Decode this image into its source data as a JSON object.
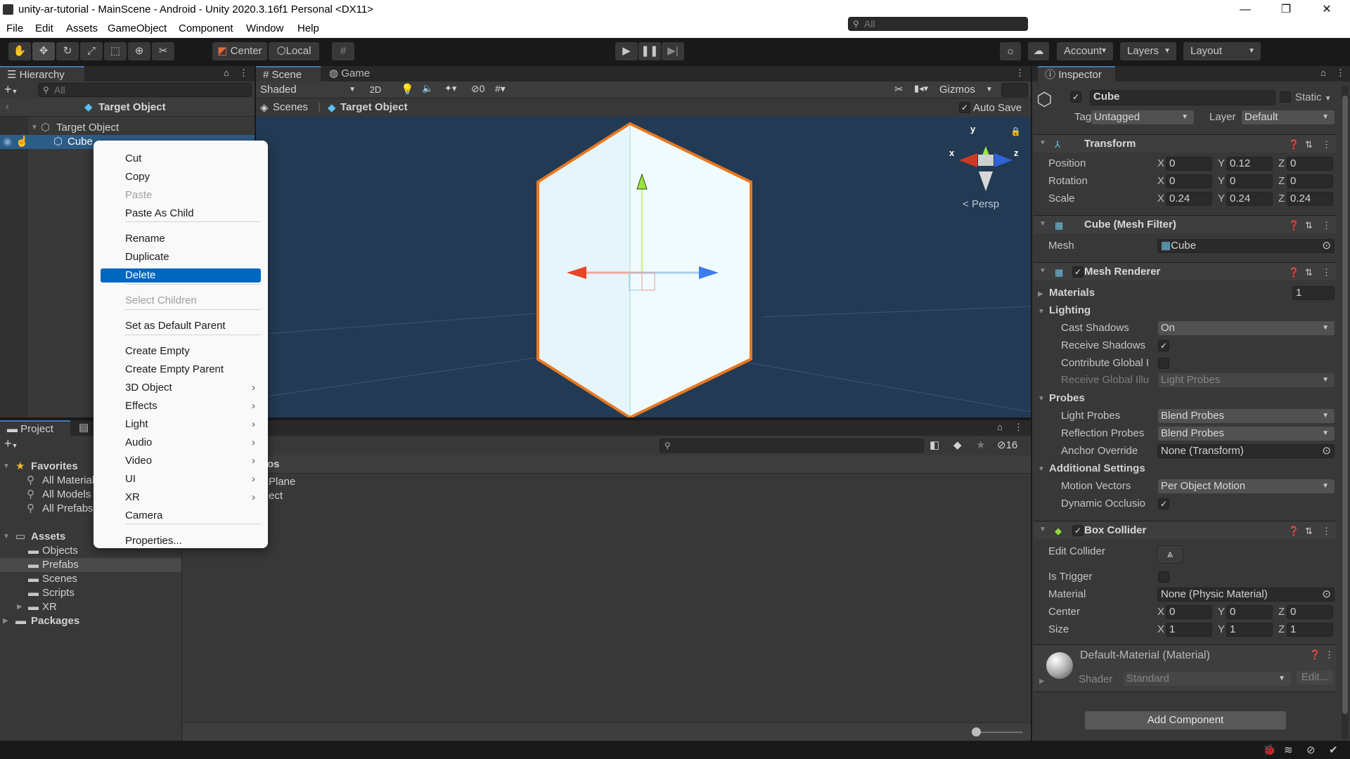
{
  "window": {
    "title": "unity-ar-tutorial - MainScene - Android - Unity 2020.3.16f1 Personal <DX11>",
    "minimize": "—",
    "maximize": "❐",
    "close": "✕"
  },
  "menubar": [
    "File",
    "Edit",
    "Assets",
    "GameObject",
    "Component",
    "Window",
    "Help"
  ],
  "toolbar": {
    "tools": [
      "hand-tool",
      "move-tool",
      "rotate-tool",
      "scale-tool",
      "rect-tool",
      "transform-tool",
      "custom-tool"
    ],
    "active_tool": "move-tool",
    "pivot_label": "Center",
    "space_label": "Local",
    "account_label": "Account",
    "layers_label": "Layers",
    "layout_label": "Layout"
  },
  "hierarchy": {
    "tab_label": "Hierarchy",
    "search_placeholder": "All",
    "breadcrumb": "Target Object",
    "items": [
      {
        "label": "Target Object",
        "expanded": true,
        "selected": false
      },
      {
        "label": "Cube",
        "selected": true
      }
    ]
  },
  "context_menu": {
    "items": [
      {
        "label": "Cut",
        "disabled": false
      },
      {
        "label": "Copy",
        "disabled": false
      },
      {
        "label": "Paste",
        "disabled": true
      },
      {
        "label": "Paste As Child",
        "disabled": false
      },
      {
        "label": "Rename",
        "disabled": false
      },
      {
        "label": "Duplicate",
        "disabled": false
      },
      {
        "label": "Delete",
        "disabled": false,
        "highlighted": true
      },
      {
        "label": "Select Children",
        "disabled": true
      },
      {
        "label": "Set as Default Parent",
        "disabled": false
      },
      {
        "label": "Create Empty",
        "disabled": false
      },
      {
        "label": "Create Empty Parent",
        "disabled": false
      },
      {
        "label": "3D Object",
        "submenu": true
      },
      {
        "label": "Effects",
        "submenu": true
      },
      {
        "label": "Light",
        "submenu": true
      },
      {
        "label": "Audio",
        "submenu": true
      },
      {
        "label": "Video",
        "submenu": true
      },
      {
        "label": "UI",
        "submenu": true
      },
      {
        "label": "XR",
        "submenu": true
      },
      {
        "label": "Camera",
        "disabled": false
      },
      {
        "label": "Properties...",
        "disabled": false
      }
    ],
    "submenu_glyph": "›"
  },
  "scene": {
    "tabs": [
      "Scene",
      "Game"
    ],
    "shading_mode": "Shaded",
    "mode_2d": "2D",
    "hidden_count": "0",
    "gizmos_label": "Gizmos",
    "search_placeholder": "All",
    "breadcrumb_root": "Scenes",
    "breadcrumb_item": "Target Object",
    "auto_save_label": "Auto Save",
    "auto_save_checked": true,
    "gizmo_axes": {
      "x": "x",
      "y": "y",
      "z": "z"
    },
    "projection_label": "Persp",
    "colors": {
      "x_axis": "#e8452a",
      "y_axis": "#9be53c",
      "z_axis": "#3d7bf0",
      "selection_outline": "#f07a1a",
      "background": "#233a55"
    }
  },
  "project": {
    "tabs": [
      "Project",
      "Console"
    ],
    "favorites_label": "Favorites",
    "favorites": [
      "All Materials",
      "All Models",
      "All Prefabs"
    ],
    "assets_label": "Assets",
    "asset_folders": [
      "Objects",
      "Prefabs",
      "Scenes",
      "Scripts",
      "XR"
    ],
    "selected_folder": "Prefabs",
    "packages_label": "Packages",
    "content_header_partial": "os",
    "content_items_partial": [
      "Plane",
      "ect"
    ],
    "hidden_count": "16",
    "zoom_slider_value": 0
  },
  "inspector": {
    "tab_label": "Inspector",
    "object_active": true,
    "object_name": "Cube",
    "static_label": "Static",
    "static_checked": false,
    "tag_label": "Tag",
    "tag_value": "Untagged",
    "layer_label": "Layer",
    "layer_value": "Default",
    "transform": {
      "title": "Transform",
      "rows": [
        {
          "label": "Position",
          "x": "0",
          "y": "0.12",
          "z": "0"
        },
        {
          "label": "Rotation",
          "x": "0",
          "y": "0",
          "z": "0"
        },
        {
          "label": "Scale",
          "x": "0.24",
          "y": "0.24",
          "z": "0.24"
        }
      ]
    },
    "mesh_filter": {
      "title": "Cube (Mesh Filter)",
      "mesh_label": "Mesh",
      "mesh_value": "Cube"
    },
    "mesh_renderer": {
      "title": "Mesh Renderer",
      "enabled": true,
      "materials_label": "Materials",
      "materials_count": "1",
      "lighting_label": "Lighting",
      "cast_shadows_label": "Cast Shadows",
      "cast_shadows_value": "On",
      "receive_shadows_label": "Receive Shadows",
      "receive_shadows_checked": true,
      "contribute_gi_label": "Contribute Global I",
      "contribute_gi_checked": false,
      "receive_gi_label": "Receive Global Illu",
      "receive_gi_value": "Light Probes",
      "probes_label": "Probes",
      "light_probes_label": "Light Probes",
      "light_probes_value": "Blend Probes",
      "reflection_probes_label": "Reflection Probes",
      "reflection_probes_value": "Blend Probes",
      "anchor_override_label": "Anchor Override",
      "anchor_override_value": "None (Transform)",
      "additional_label": "Additional Settings",
      "motion_vectors_label": "Motion Vectors",
      "motion_vectors_value": "Per Object Motion",
      "dynamic_occlusion_label": "Dynamic Occlusio",
      "dynamic_occlusion_checked": true
    },
    "box_collider": {
      "title": "Box Collider",
      "enabled": true,
      "edit_collider_label": "Edit Collider",
      "is_trigger_label": "Is Trigger",
      "is_trigger_checked": false,
      "material_label": "Material",
      "material_value": "None (Physic Material)",
      "center": {
        "label": "Center",
        "x": "0",
        "y": "0",
        "z": "0"
      },
      "size": {
        "label": "Size",
        "x": "1",
        "y": "1",
        "z": "1"
      }
    },
    "material": {
      "title": "Default-Material (Material)",
      "shader_label": "Shader",
      "shader_value": "Standard",
      "edit_label": "Edit..."
    },
    "add_component_label": "Add Component"
  },
  "statusbar": {
    "icons": [
      "debug-off-icon",
      "cache-off-icon",
      "network-off-icon",
      "check-circle-icon"
    ]
  }
}
